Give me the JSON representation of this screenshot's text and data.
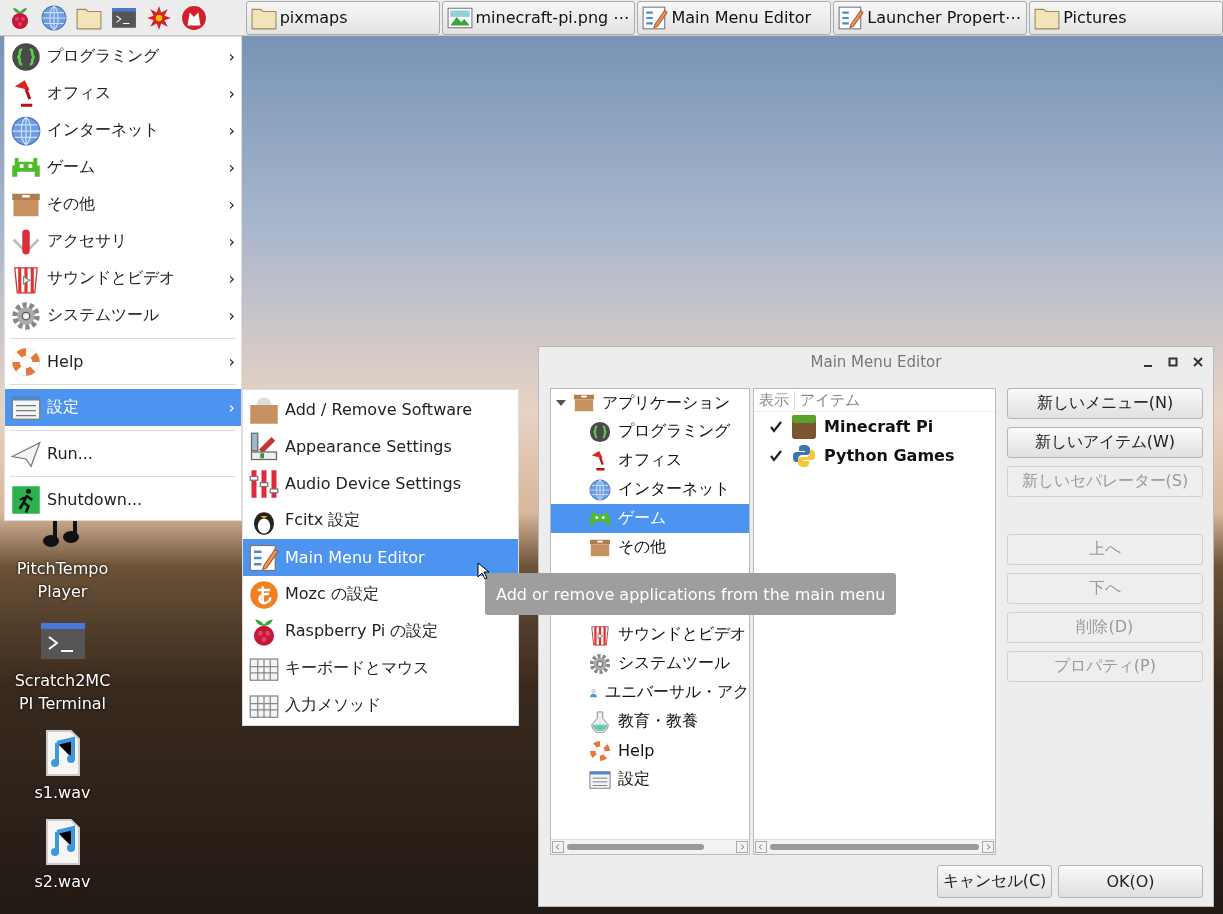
{
  "taskbar": {
    "windows": [
      {
        "label": "pixmaps",
        "selected": false
      },
      {
        "label": "minecraft-pi.png ⋯",
        "selected": false
      },
      {
        "label": "Main Menu Editor",
        "selected": false
      },
      {
        "label": "Launcher Propert⋯",
        "selected": false
      },
      {
        "label": "Pictures",
        "selected": false
      }
    ]
  },
  "desktop_icons": [
    {
      "label": "PitchTempo Player"
    },
    {
      "label": "Scratch2MC PI Terminal"
    },
    {
      "label": "s1.wav"
    },
    {
      "label": "s2.wav"
    }
  ],
  "main_menu": {
    "items": [
      {
        "kind": "item",
        "label": "プログラミング",
        "arrow": "›",
        "selected": false
      },
      {
        "kind": "item",
        "label": "オフィス",
        "arrow": "›",
        "selected": false
      },
      {
        "kind": "item",
        "label": "インターネット",
        "arrow": "›",
        "selected": false
      },
      {
        "kind": "item",
        "label": "ゲーム",
        "arrow": "›",
        "selected": false
      },
      {
        "kind": "item",
        "label": "その他",
        "arrow": "›",
        "selected": false
      },
      {
        "kind": "item",
        "label": "アクセサリ",
        "arrow": "›",
        "selected": false
      },
      {
        "kind": "item",
        "label": "サウンドとビデオ",
        "arrow": "›",
        "selected": false
      },
      {
        "kind": "item",
        "label": "システムツール",
        "arrow": "›",
        "selected": false
      },
      {
        "kind": "separator"
      },
      {
        "kind": "item",
        "label": "Help",
        "arrow": "›",
        "selected": false
      },
      {
        "kind": "separator"
      },
      {
        "kind": "item",
        "label": "設定",
        "arrow": "›",
        "selected": true
      },
      {
        "kind": "separator"
      },
      {
        "kind": "item",
        "label": "Run...",
        "selected": false
      },
      {
        "kind": "separator"
      },
      {
        "kind": "item",
        "label": "Shutdown...",
        "selected": false
      }
    ]
  },
  "submenu": {
    "items": [
      {
        "label": "Add / Remove Software",
        "selected": false
      },
      {
        "label": "Appearance Settings",
        "selected": false
      },
      {
        "label": "Audio Device Settings",
        "selected": false
      },
      {
        "label": "Fcitx 設定",
        "selected": false
      },
      {
        "label": "Main Menu Editor",
        "selected": true
      },
      {
        "label": "Mozc の設定",
        "selected": false
      },
      {
        "label": "Raspberry Pi の設定",
        "selected": false
      },
      {
        "label": "キーボードとマウス",
        "selected": false
      },
      {
        "label": "入力メソッド",
        "selected": false
      }
    ]
  },
  "tooltip": {
    "text": "Add or remove applications from the main menu"
  },
  "dialog": {
    "title": "Main Menu Editor",
    "tree": {
      "label": "アプリケーション",
      "expanded": true,
      "children": [
        {
          "kind": "item",
          "label": "プログラミング",
          "selected": false
        },
        {
          "kind": "item",
          "label": "オフィス",
          "selected": false
        },
        {
          "kind": "item",
          "label": "インターネット",
          "selected": false
        },
        {
          "kind": "item",
          "label": "ゲーム",
          "selected": true
        },
        {
          "kind": "item",
          "label": "その他",
          "selected": false
        },
        {
          "kind": "covered"
        },
        {
          "kind": "covered"
        },
        {
          "kind": "item",
          "label": "サウンドとビデオ",
          "selected": false
        },
        {
          "kind": "item",
          "label": "システムツール",
          "selected": false
        },
        {
          "kind": "item",
          "label": "ユニバーサル・アク",
          "selected": false
        },
        {
          "kind": "item",
          "label": "教育・教養",
          "selected": false
        },
        {
          "kind": "item",
          "label": "Help",
          "selected": false
        },
        {
          "kind": "item",
          "label": "設定",
          "selected": false
        }
      ]
    },
    "columns": [
      "表示",
      "アイテム"
    ],
    "rows": [
      {
        "checked": true,
        "label": "Minecraft Pi"
      },
      {
        "checked": true,
        "label": "Python Games"
      }
    ],
    "item_buttons": [
      {
        "label": "新しいメニュー(N)",
        "disabled": false
      },
      {
        "label": "新しいアイテム(W)",
        "disabled": false
      },
      {
        "label": "新しいセパレーター(S)",
        "disabled": true
      }
    ],
    "move_buttons": [
      {
        "label": "上へ",
        "disabled": true
      },
      {
        "label": "下へ",
        "disabled": true
      },
      {
        "label": "削除(D)",
        "disabled": true
      },
      {
        "label": "プロパティ(P)",
        "disabled": true
      }
    ],
    "footer_buttons": [
      {
        "label": "キャンセル(C)",
        "disabled": false
      },
      {
        "label": "OK(O)",
        "disabled": false
      }
    ]
  }
}
